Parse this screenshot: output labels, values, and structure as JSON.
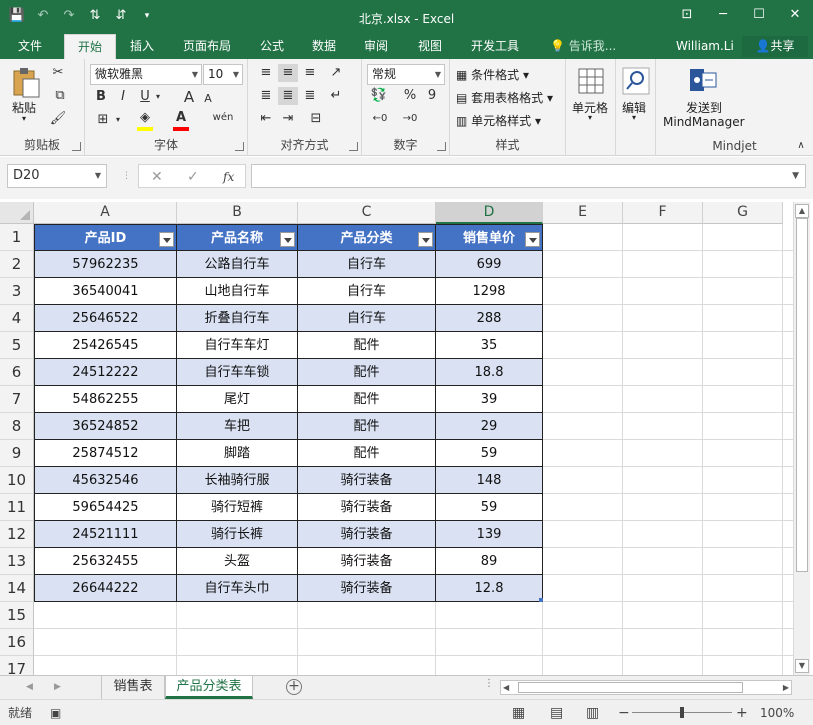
{
  "window": {
    "title": "北京.xlsx - Excel",
    "min_glyph": "─",
    "max_glyph": "☐",
    "close_glyph": "✕",
    "ribbon_opt_glyph": "⊡"
  },
  "qat": [
    "💾",
    "↶",
    "↷",
    "⇅",
    "⇵",
    "▾"
  ],
  "tabs": [
    "文件",
    "开始",
    "插入",
    "页面布局",
    "公式",
    "数据",
    "审阅",
    "视图",
    "开发工具"
  ],
  "active_tab": "开始",
  "tell_me": "告诉我...",
  "user": "William.Li",
  "share": "共享",
  "ribbon": {
    "clipboard": {
      "label": "剪贴板",
      "paste": "粘贴"
    },
    "font": {
      "label": "字体",
      "name": "微软雅黑",
      "size": "10",
      "bold": "B",
      "italic": "I",
      "underline": "U",
      "grow": "A",
      "shrink": "A",
      "phonetic": "wén",
      "fill_color": "#ffff00",
      "font_color": "#ff0000"
    },
    "alignment": {
      "label": "对齐方式"
    },
    "number": {
      "label": "数字",
      "format": "常规",
      "percent": "%",
      "comma": "9"
    },
    "styles": {
      "label": "样式",
      "cond": "条件格式",
      "table": "套用表格格式",
      "cell": "单元格样式"
    },
    "cells": {
      "label": "单元格"
    },
    "editing": {
      "label": "编辑"
    },
    "mindjet": {
      "label": "Mindjet",
      "send_line1": "发送到",
      "send_line2": "MindManager"
    }
  },
  "namebox": "D20",
  "formula": "",
  "fx": "fx",
  "columns": [
    "A",
    "B",
    "C",
    "D",
    "E",
    "F",
    "G"
  ],
  "selected_column": "D",
  "rows": [
    "1",
    "2",
    "3",
    "4",
    "5",
    "6",
    "7",
    "8",
    "9",
    "10",
    "11",
    "12",
    "13",
    "14",
    "15",
    "16",
    "17"
  ],
  "table": {
    "headers": [
      "产品ID",
      "产品名称",
      "产品分类",
      "销售单价"
    ],
    "header_color": "#4472c4",
    "band_color": "#d9e1f2",
    "data": [
      [
        "57962235",
        "公路自行车",
        "自行车",
        "699"
      ],
      [
        "36540041",
        "山地自行车",
        "自行车",
        "1298"
      ],
      [
        "25646522",
        "折叠自行车",
        "自行车",
        "288"
      ],
      [
        "25426545",
        "自行车车灯",
        "配件",
        "35"
      ],
      [
        "24512222",
        "自行车车锁",
        "配件",
        "18.8"
      ],
      [
        "54862255",
        "尾灯",
        "配件",
        "39"
      ],
      [
        "36524852",
        "车把",
        "配件",
        "29"
      ],
      [
        "25874512",
        "脚踏",
        "配件",
        "59"
      ],
      [
        "45632546",
        "长袖骑行服",
        "骑行装备",
        "148"
      ],
      [
        "59654425",
        "骑行短裤",
        "骑行装备",
        "59"
      ],
      [
        "24521111",
        "骑行长裤",
        "骑行装备",
        "139"
      ],
      [
        "25632455",
        "头盔",
        "骑行装备",
        "89"
      ],
      [
        "26644222",
        "自行车头巾",
        "骑行装备",
        "12.8"
      ]
    ]
  },
  "sheets": [
    "销售表",
    "产品分类表"
  ],
  "active_sheet": "产品分类表",
  "status": {
    "ready": "就绪",
    "zoom": "100%",
    "minus": "−",
    "plus": "+"
  }
}
